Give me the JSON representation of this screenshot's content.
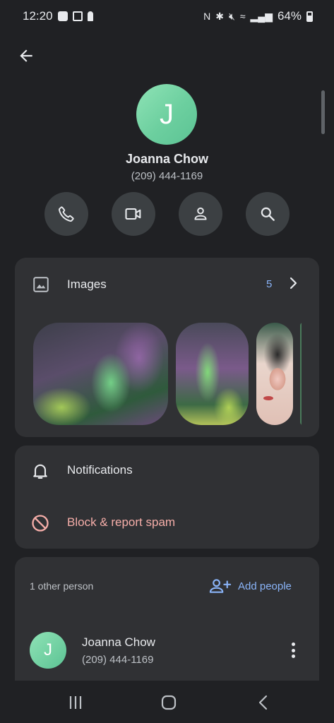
{
  "status_bar": {
    "time": "12:20",
    "battery": "64%",
    "icons_left": [
      "image-icon",
      "calendar-icon",
      "keyhole-icon"
    ],
    "icons_right": [
      "nfc-icon",
      "bluetooth-icon",
      "mute-icon",
      "wifi-icon",
      "signal-icon",
      "battery-icon"
    ]
  },
  "contact": {
    "initial": "J",
    "name": "Joanna Chow",
    "phone": "(209) 444-1169",
    "avatar_color": "#6ccf9f"
  },
  "actions": [
    "call-icon",
    "video-icon",
    "contact-icon",
    "search-icon"
  ],
  "images": {
    "label": "Images",
    "count": "5"
  },
  "settings": {
    "notifications_label": "Notifications",
    "block_label": "Block & report spam",
    "block_color": "#f6aea9"
  },
  "people": {
    "summary": "1 other person",
    "add_label": "Add people",
    "members": [
      {
        "initial": "J",
        "name": "Joanna Chow",
        "phone": "(209) 444-1169"
      }
    ]
  },
  "colors": {
    "background": "#202124",
    "card": "#303134",
    "accent": "#8ab4f8"
  }
}
